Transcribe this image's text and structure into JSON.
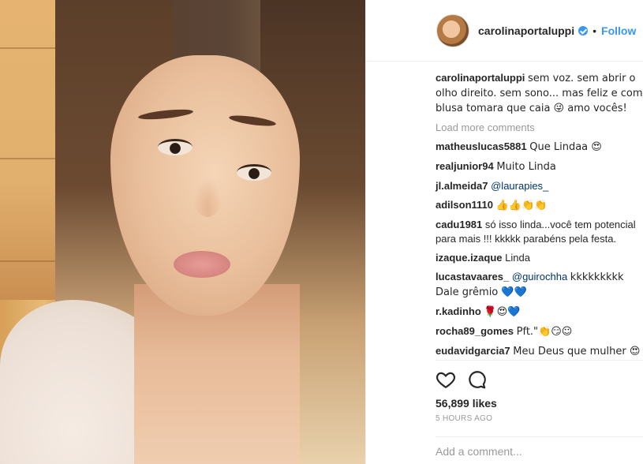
{
  "post": {
    "username": "carolinaportaluppi",
    "follow_label": "Follow",
    "dot": "•",
    "caption": "sem voz. sem abrir o olho direito. sem sono... mas feliz e com blusa tomara que caia 😜 amo vocês!",
    "load_more": "Load more comments",
    "likes": "56,899 likes",
    "time": "5 HOURS AGO",
    "add_comment_placeholder": "Add a comment..."
  },
  "comments": [
    {
      "user": "matheuslucas5881",
      "text": "Que Lindaa 😍"
    },
    {
      "user": "realjunior94",
      "text": "Muito Linda"
    },
    {
      "user": "jl.almeida7",
      "mention": "@laurapies_",
      "text": ""
    },
    {
      "user": "adilson1110",
      "text": "👍👍👏👏"
    },
    {
      "user": "cadu1981",
      "text": "só isso linda...você tem potencial para mais !!! kkkkk parabéns pela festa."
    },
    {
      "user": "izaque.izaque",
      "text": "Linda"
    },
    {
      "user": "lucastavaares_",
      "mention": "@guirochha",
      "text": "kkkkkkkkk Dale grêmio 💙💙"
    },
    {
      "user": "r.kadinho",
      "text": "🌹😍💙"
    },
    {
      "user": "rocha89_gomes",
      "text": "Pft.\"👏😏☺"
    },
    {
      "user": "eudavidgarcia7",
      "text": "Meu Deus que mulher 😍"
    }
  ],
  "icons": [
    "heart-icon",
    "comment-icon",
    "verified-icon"
  ],
  "colors": {
    "link": "#3897f0",
    "muted": "#999999",
    "text": "#262626"
  }
}
